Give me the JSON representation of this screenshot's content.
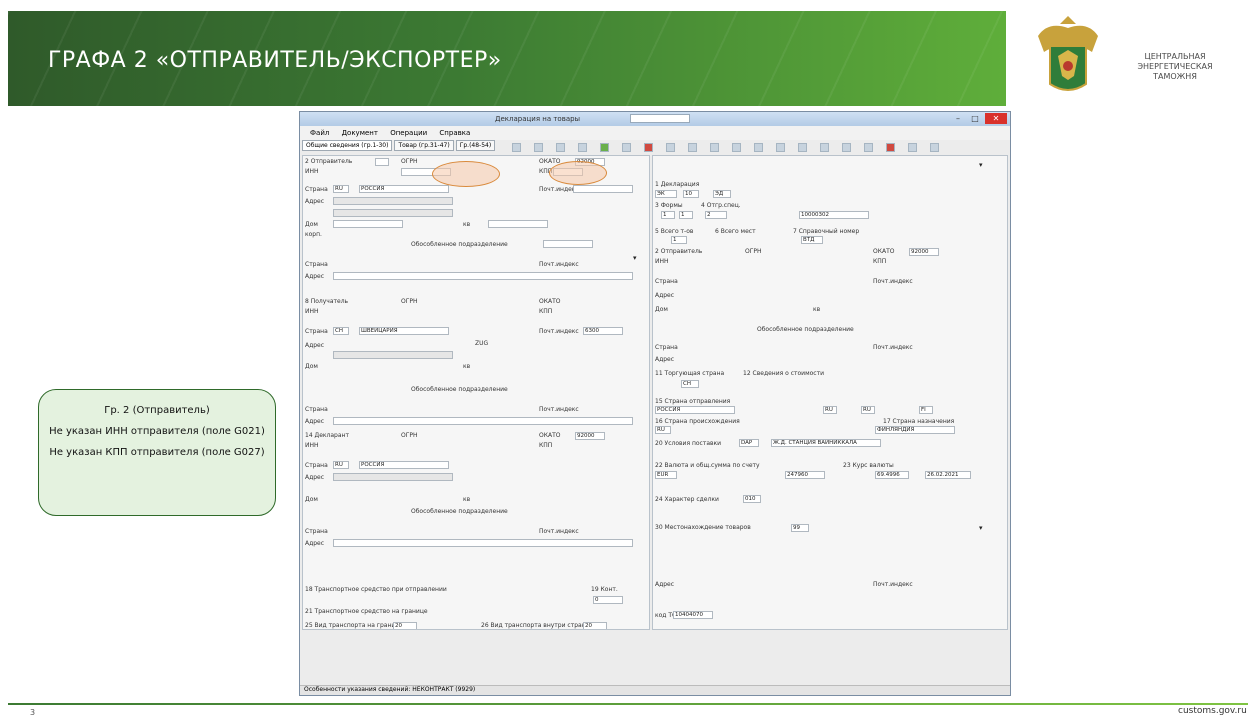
{
  "slide": {
    "title": "ГРАФА  2 «ОТПРАВИТЕЛЬ/ЭКСПОРТЕР»",
    "org_name": "ЦЕНТРАЛЬНАЯ ЭНЕРГЕТИЧЕСКАЯ ТАМОЖНЯ",
    "page_number": "3",
    "site": "customs.gov.ru",
    "accent_color": "#3c7a33"
  },
  "callout": {
    "heading": "Гр. 2 (Отправитель)",
    "line1": "Не указан ИНН отправителя (поле G021)",
    "line2": "Не указан КПП отправителя (поле G027)"
  },
  "window": {
    "title": "Декларация на товары",
    "menu": [
      "Файл",
      "Документ",
      "Операции",
      "Справка"
    ],
    "tabs": [
      "Общие сведения (гр.1-30)",
      "Товар (гр.31-47)",
      "Гр.(48-54)"
    ],
    "status": "Особенности указания сведений: НЕКОНТРАКТ (9929)",
    "close_label": "✕",
    "max_label": "□",
    "min_label": "–"
  },
  "left": {
    "sender_label": "2 Отправитель",
    "ogrn_label": "ОГРН",
    "okato_label": "ОКАТО",
    "inn_label": "ИНН",
    "kpp_label": "КПП",
    "okato_value": "92000",
    "country_label": "Страна",
    "country_code": "RU",
    "country_name": "РОССИЯ",
    "post_label": "Почт.индекс",
    "address_label": "Адрес",
    "house_label": "Дом",
    "flat_label": "кв",
    "building_label": "корп.",
    "subdivision_label": "Обособленное подразделение",
    "recipient_label": "8 Получатель",
    "recipient_country_code": "CH",
    "recipient_country_name": "ШВЕЙЦАРИЯ",
    "recipient_post": "6300",
    "recipient_city": "ZUG",
    "declarant_label": "14 Декларант",
    "transport_label": "18 Транспортное средство при отправлении",
    "border_transport_label": "21 Транспортное средство на границе",
    "transport_mode_label": "25 Вид транспорта на границе",
    "inland_mode_label": "26 Вид транспорта внутри страны",
    "transport_mode_value": "20",
    "inland_mode_value": "20",
    "container_label": "19 Конт.",
    "container_value": "0"
  },
  "right": {
    "decl_type_label": "1 Декларация",
    "decl_type_values": [
      "ЭК",
      "10",
      "ЭД"
    ],
    "forms_label": "3 Формы",
    "forms_values": [
      "1",
      "1"
    ],
    "spec_label": "4 Отгр.спец.",
    "spec_value": "2",
    "ref_value": "10000302",
    "items_label": "5 Всего т-ов",
    "items_value": "1",
    "packages_label": "6 Всего мест",
    "ref_number_label": "7 Справочный номер",
    "ref_number_value": "ВТД",
    "country_dispatch_label": "15 Страна отправления",
    "country_dispatch_value": "РОССИЯ",
    "dispatch_codes": [
      "RU",
      "RU",
      "FI"
    ],
    "country_origin_label": "16 Страна происхождения",
    "country_origin_value": "RU",
    "destination_label": "17 Страна назначения",
    "destination_value": "ФИНЛЯНДИЯ",
    "delivery_label": "20 Условия поставки",
    "delivery_value": "DAP",
    "delivery_place": "Ж.Д. СТАНЦИЯ ВАЙНИККАЛА",
    "currency_label": "22 Валюта и общ.сумма по счету",
    "currency_value": "EUR",
    "invoice_total": "247960",
    "rate_label": "23 Курс валюты",
    "rate_value": "69.4996",
    "rate_date": "26.02.2021",
    "trade_label": "11 Торгующая страна",
    "trade_value": "CH",
    "customs_value_label": "12 Сведения о стоимости",
    "transaction_label": "24 Характер сделки",
    "transaction_value": "010",
    "location_label": "30 Местонахождение товаров",
    "location_code": "99",
    "code_label": "код ТО",
    "code_value": "10404070"
  }
}
